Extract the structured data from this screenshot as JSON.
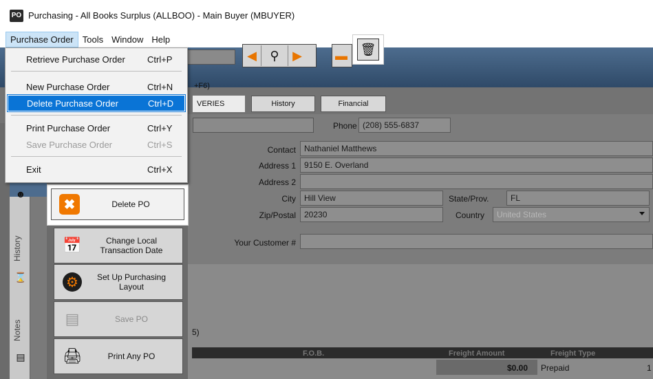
{
  "window": {
    "app_badge": "PO",
    "title": "Purchasing - All Books Surplus (ALLBOO) - Main Buyer (MBUYER)"
  },
  "menubar": {
    "items": [
      {
        "label": "Purchase Order"
      },
      {
        "label": "Tools"
      },
      {
        "label": "Window"
      },
      {
        "label": "Help"
      }
    ]
  },
  "dropdown": {
    "items": [
      {
        "label": "Retrieve Purchase Order",
        "shortcut": "Ctrl+P"
      },
      {
        "label": "New Purchase Order",
        "shortcut": "Ctrl+N"
      },
      {
        "label": "Delete Purchase Order",
        "shortcut": "Ctrl+D"
      },
      {
        "label": "Print Purchase Order",
        "shortcut": "Ctrl+Y"
      },
      {
        "label": "Save Purchase Order",
        "shortcut": "Ctrl+S"
      },
      {
        "label": "Exit",
        "shortcut": "Ctrl+X"
      }
    ]
  },
  "search_hint": "+F6)",
  "tabs": {
    "deliveries": "VERIES",
    "history": "History",
    "financial": "Financial"
  },
  "vendor": {
    "phone_label": "Phone",
    "phone": "(208) 555-6837",
    "contact_label": "Contact",
    "contact": "Nathaniel Matthews",
    "address1_label": "Address 1",
    "address1": "9150 E. Overland",
    "address2_label": "Address 2",
    "address2": "",
    "city_label": "City",
    "city": "Hill View",
    "state_label": "State/Prov.",
    "state": "FL",
    "zip_label": "Zip/Postal",
    "zip": "20230",
    "country_label": "Country",
    "country": "United States",
    "customer_label": "Your Customer #",
    "customer": ""
  },
  "freight": {
    "section_suffix": "5)",
    "col_fob": "F.O.B.",
    "col_amount": "Freight Amount",
    "col_type": "Freight Type",
    "amount": "$0.00",
    "type": "Prepaid",
    "trailing": "1"
  },
  "side_tabs": {
    "history": "History",
    "notes": "Notes"
  },
  "actions": {
    "delete": "Delete PO",
    "change_date": "Change Local Transaction Date",
    "setup_layout": "Set Up Purchasing Layout",
    "save": "Save PO",
    "print": "Print Any PO"
  },
  "colors": {
    "selection": "#0a74d6",
    "accent_orange": "#f07800",
    "band_blue": "#4d6c8e"
  }
}
